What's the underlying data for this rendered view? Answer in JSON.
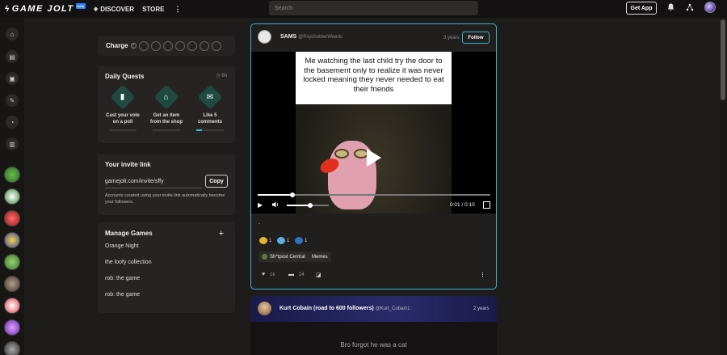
{
  "topbar": {
    "brand": "GAME JOLT",
    "brand_badge": "beta",
    "nav": [
      {
        "label": "DISCOVER",
        "icon": "compass-icon"
      },
      {
        "label": "STORE"
      }
    ],
    "more_icon": "⋮",
    "search_placeholder": "Search",
    "get_app_label": "Get App"
  },
  "charge": {
    "label": "Charge",
    "help_icon": "?"
  },
  "daily_quests": {
    "title": "Daily Quests",
    "timer": "6h",
    "quests": [
      {
        "line1": "Cast your vote",
        "line2": "on a poll",
        "progress": 0
      },
      {
        "line1": "Get an item",
        "line2": "from the shop",
        "progress": 0
      },
      {
        "line1": "Like 5",
        "line2": "comments",
        "progress": 0.2
      }
    ]
  },
  "invite": {
    "title": "Your invite link",
    "link": "gamejolt.com/invite/sffy",
    "copy_label": "Copy",
    "description": "Accounts created using your invite link automatically become your followers."
  },
  "manage_games": {
    "title": "Manage Games",
    "plus": "+",
    "games": [
      "Orange Night",
      "the loofy collection",
      "rob: the game",
      "rob: the game"
    ]
  },
  "post": {
    "author_name": "SAMS",
    "author_handle": "@PsychotherWeeds",
    "time": "3 years",
    "follow_label": "Follow",
    "video_caption": "Me watching the last child try the door to the basement only to realize it was never locked meaning they never needed to eat their friends",
    "video_progress": 0.15,
    "volume_level": 0.55,
    "video_time": "0:01 / 0:10",
    "body": ".",
    "reactions": [
      {
        "count": "1",
        "color": "#e8b030"
      },
      {
        "count": "1",
        "color": "#5ab0e0"
      },
      {
        "count": "1",
        "color": "#3070c0"
      }
    ],
    "tags": [
      "Sh*tpost Central",
      "Memes"
    ],
    "likes": "1k",
    "comments": "24"
  },
  "post2": {
    "author_name": "Kurt Cobain (road to 600 followers)",
    "author_handle": "@Kurt_Cobain1",
    "time": "2 years",
    "caption": "Bro forgot he was a cat"
  }
}
